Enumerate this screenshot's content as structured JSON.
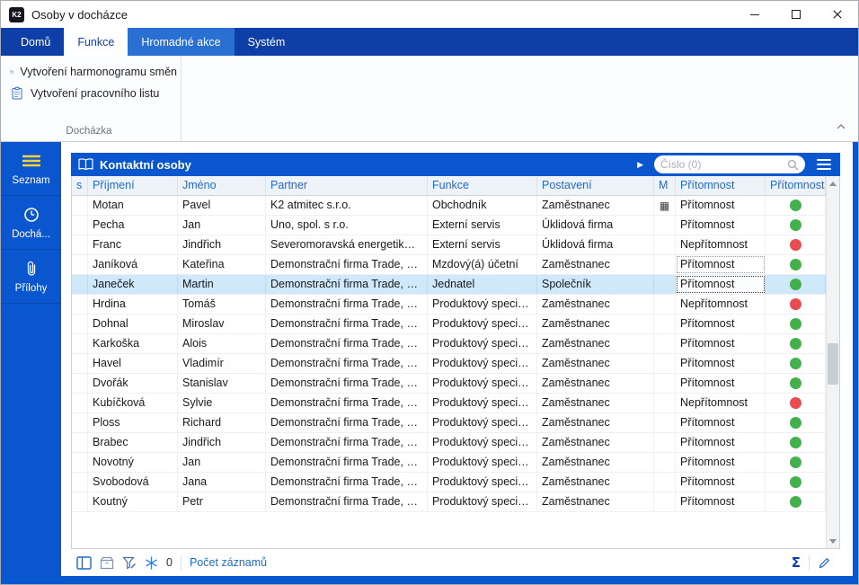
{
  "window": {
    "logo": "K2",
    "title": "Osoby v docházce"
  },
  "ribbon": {
    "tabs": [
      {
        "label": "Domů"
      },
      {
        "label": "Funkce"
      },
      {
        "label": "Hromadné akce"
      },
      {
        "label": "Systém"
      }
    ],
    "actions": [
      {
        "label": "Vytvoření harmonogramu směn"
      },
      {
        "label": "Vytvoření pracovního listu"
      }
    ],
    "group_label": "Docházka"
  },
  "sidebar": [
    {
      "label": "Seznam"
    },
    {
      "label": "Dochá..."
    },
    {
      "label": "Přílohy"
    }
  ],
  "panel": {
    "title": "Kontaktní osoby",
    "search_placeholder": "Číslo (0)"
  },
  "table": {
    "columns": [
      "s",
      "Příjmení",
      "Jméno",
      "Partner",
      "Funkce",
      "Postavení",
      "M",
      "Přítomnost",
      "Přítomnost"
    ],
    "rows": [
      {
        "prijmeni": "Motan",
        "jmeno": "Pavel",
        "partner": "K2 atmitec s.r.o.",
        "funkce": "Obchodník",
        "postaveni": "Zaměstnanec",
        "m_icon": true,
        "pritomnost": "Přítomnost",
        "status": "green"
      },
      {
        "prijmeni": "Pecha",
        "jmeno": "Jan",
        "partner": "Uno, spol. s r.o.",
        "funkce": "Externí servis",
        "postaveni": "Úklidová firma",
        "pritomnost": "Přítomnost",
        "status": "green"
      },
      {
        "prijmeni": "Franc",
        "jmeno": "Jindřich",
        "partner": "Severomoravská energetik…",
        "funkce": "Externí servis",
        "postaveni": "Úklidová firma",
        "pritomnost": "Nepřítomnost",
        "status": "red"
      },
      {
        "prijmeni": "Janíková",
        "jmeno": "Kateřina",
        "partner": "Demonstrační firma Trade, …",
        "funkce": "Mzdový(á) účetní",
        "postaveni": "Zaměstnanec",
        "pritomnost": "Přítomnost",
        "status": "green",
        "marker": true
      },
      {
        "prijmeni": "Janeček",
        "jmeno": "Martin",
        "partner": "Demonstrační firma Trade, …",
        "funkce": "Jednatel",
        "postaveni": "Společník",
        "pritomnost": "Přítomnost",
        "status": "green",
        "selected": true,
        "focus": true
      },
      {
        "prijmeni": "Hrdina",
        "jmeno": "Tomáš",
        "partner": "Demonstrační firma Trade, …",
        "funkce": "Produktový speci…",
        "postaveni": "Zaměstnanec",
        "pritomnost": "Nepřítomnost",
        "status": "red"
      },
      {
        "prijmeni": "Dohnal",
        "jmeno": "Miroslav",
        "partner": "Demonstrační firma Trade, …",
        "funkce": "Produktový speci…",
        "postaveni": "Zaměstnanec",
        "pritomnost": "Přítomnost",
        "status": "green"
      },
      {
        "prijmeni": "Karkoška",
        "jmeno": "Alois",
        "partner": "Demonstrační firma Trade, …",
        "funkce": "Produktový speci…",
        "postaveni": "Zaměstnanec",
        "pritomnost": "Přítomnost",
        "status": "green"
      },
      {
        "prijmeni": "Havel",
        "jmeno": "Vladimír",
        "partner": "Demonstrační firma Trade, …",
        "funkce": "Produktový speci…",
        "postaveni": "Zaměstnanec",
        "pritomnost": "Přítomnost",
        "status": "green"
      },
      {
        "prijmeni": "Dvořák",
        "jmeno": "Stanislav",
        "partner": "Demonstrační firma Trade, …",
        "funkce": "Produktový speci…",
        "postaveni": "Zaměstnanec",
        "pritomnost": "Přítomnost",
        "status": "green"
      },
      {
        "prijmeni": "Kubíčková",
        "jmeno": "Sylvie",
        "partner": "Demonstrační firma Trade, …",
        "funkce": "Produktový speci…",
        "postaveni": "Zaměstnanec",
        "pritomnost": "Nepřítomnost",
        "status": "red"
      },
      {
        "prijmeni": "Ploss",
        "jmeno": "Richard",
        "partner": "Demonstrační firma Trade, …",
        "funkce": "Produktový speci…",
        "postaveni": "Zaměstnanec",
        "pritomnost": "Přítomnost",
        "status": "green"
      },
      {
        "prijmeni": "Brabec",
        "jmeno": "Jindřich",
        "partner": "Demonstrační firma Trade, …",
        "funkce": "Produktový speci…",
        "postaveni": "Zaměstnanec",
        "pritomnost": "Přítomnost",
        "status": "green"
      },
      {
        "prijmeni": "Novotný",
        "jmeno": "Jan",
        "partner": "Demonstrační firma Trade, …",
        "funkce": "Produktový speci…",
        "postaveni": "Zaměstnanec",
        "pritomnost": "Přítomnost",
        "status": "green"
      },
      {
        "prijmeni": "Svobodová",
        "jmeno": "Jana",
        "partner": "Demonstrační firma Trade, …",
        "funkce": "Produktový speci…",
        "postaveni": "Zaměstnanec",
        "pritomnost": "Přítomnost",
        "status": "green"
      },
      {
        "prijmeni": "Koutný",
        "jmeno": "Petr",
        "partner": "Demonstrační firma Trade, …",
        "funkce": "Produktový speci…",
        "postaveni": "Zaměstnanec",
        "pritomnost": "Přítomnost",
        "status": "green"
      }
    ]
  },
  "statusbar": {
    "flake_count": "0",
    "records_label": "Počet záznamů",
    "sum_symbol": "Σ"
  },
  "colors": {
    "accent": "#0a56cf",
    "navy": "#0d3fa6",
    "tab_highlight": "#2a6fd2",
    "green": "#43b14b",
    "red": "#e94b50",
    "selection": "#cfe9fb",
    "header_text": "#1f6bc8"
  }
}
